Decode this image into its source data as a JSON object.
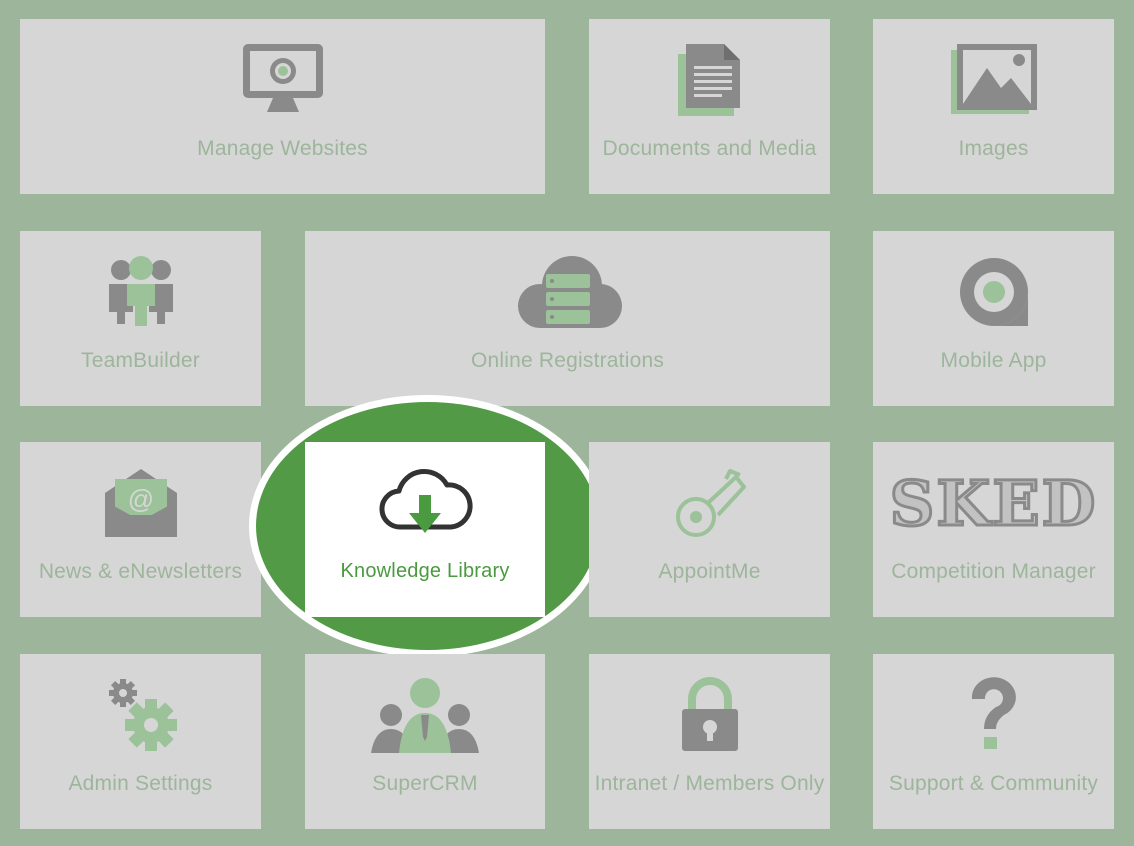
{
  "colors": {
    "background": "#9db59b",
    "tile": "#d6d6d6",
    "label": "#9db59b",
    "icon_gray": "#8a8a8a",
    "icon_green": "#9bc299",
    "highlight_green": "#529a46",
    "active_label": "#4a9a3f"
  },
  "tiles": [
    {
      "label": "Manage Websites",
      "icon": "monitor-icon"
    },
    {
      "label": "Documents and Media",
      "icon": "document-icon"
    },
    {
      "label": "Images",
      "icon": "image-icon"
    },
    {
      "label": "TeamBuilder",
      "icon": "team-icon"
    },
    {
      "label": "Online Registrations",
      "icon": "cloud-server-icon"
    },
    {
      "label": "Mobile App",
      "icon": "location-pin-icon"
    },
    {
      "label": "News & eNewsletters",
      "icon": "envelope-icon"
    },
    {
      "label": "Knowledge Library",
      "icon": "cloud-download-icon",
      "active": true
    },
    {
      "label": "AppointMe",
      "icon": "whistle-icon"
    },
    {
      "label": "Competition Manager",
      "icon": "sked-logo",
      "logo_text": "SKED"
    },
    {
      "label": "Admin Settings",
      "icon": "gears-icon"
    },
    {
      "label": "SuperCRM",
      "icon": "people-group-icon"
    },
    {
      "label": "Intranet / Members Only",
      "icon": "padlock-icon"
    },
    {
      "label": "Support & Community",
      "icon": "question-mark-icon",
      "glyph": "?"
    }
  ]
}
